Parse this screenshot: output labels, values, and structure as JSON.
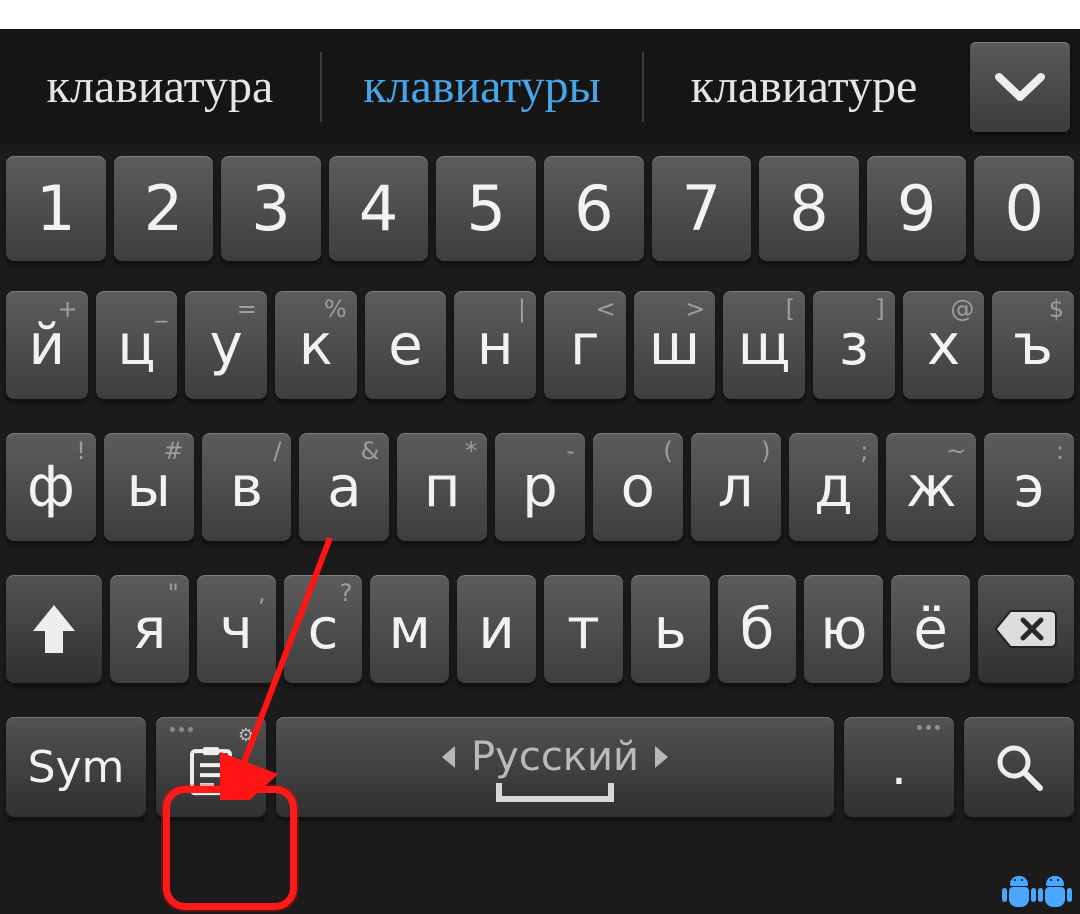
{
  "suggestions": [
    {
      "text": "клавиатура",
      "selected": false
    },
    {
      "text": "клавиатуры",
      "selected": true
    },
    {
      "text": "клавиатуре",
      "selected": false
    }
  ],
  "rows": {
    "numbers": [
      "1",
      "2",
      "3",
      "4",
      "5",
      "6",
      "7",
      "8",
      "9",
      "0"
    ],
    "r1": [
      {
        "main": "й",
        "sub": "+"
      },
      {
        "main": "ц",
        "sub": "_"
      },
      {
        "main": "у",
        "sub": "="
      },
      {
        "main": "к",
        "sub": "%"
      },
      {
        "main": "е",
        "sub": ""
      },
      {
        "main": "н",
        "sub": "|"
      },
      {
        "main": "г",
        "sub": "<"
      },
      {
        "main": "ш",
        "sub": ">"
      },
      {
        "main": "щ",
        "sub": "["
      },
      {
        "main": "з",
        "sub": "]"
      },
      {
        "main": "х",
        "sub": "@"
      },
      {
        "main": "ъ",
        "sub": "$"
      }
    ],
    "r2": [
      {
        "main": "ф",
        "sub": "!"
      },
      {
        "main": "ы",
        "sub": "#"
      },
      {
        "main": "в",
        "sub": "/"
      },
      {
        "main": "а",
        "sub": "&"
      },
      {
        "main": "п",
        "sub": "*"
      },
      {
        "main": "р",
        "sub": "-"
      },
      {
        "main": "о",
        "sub": "("
      },
      {
        "main": "л",
        "sub": ")"
      },
      {
        "main": "д",
        "sub": ";"
      },
      {
        "main": "ж",
        "sub": "~"
      },
      {
        "main": "э",
        "sub": ":"
      }
    ],
    "r3": [
      {
        "main": "я",
        "sub": "\""
      },
      {
        "main": "ч",
        "sub": ","
      },
      {
        "main": "с",
        "sub": "?"
      },
      {
        "main": "м",
        "sub": ""
      },
      {
        "main": "и",
        "sub": ""
      },
      {
        "main": "т",
        "sub": ""
      },
      {
        "main": "ь",
        "sub": ""
      },
      {
        "main": "б",
        "sub": ""
      },
      {
        "main": "ю",
        "sub": ""
      },
      {
        "main": "ё",
        "sub": ""
      }
    ]
  },
  "bottom": {
    "sym": "Sym",
    "space_language": "Русский",
    "dot": "."
  },
  "icons": {
    "expand": "chevron-down-icon",
    "shift": "shift-arrow-icon",
    "backspace": "backspace-icon",
    "options": "clipboard-options-icon",
    "gear": "gear-icon",
    "search": "search-icon"
  },
  "annotation": {
    "highlight_target": "options-key",
    "arrow_color": "#ff1414"
  }
}
